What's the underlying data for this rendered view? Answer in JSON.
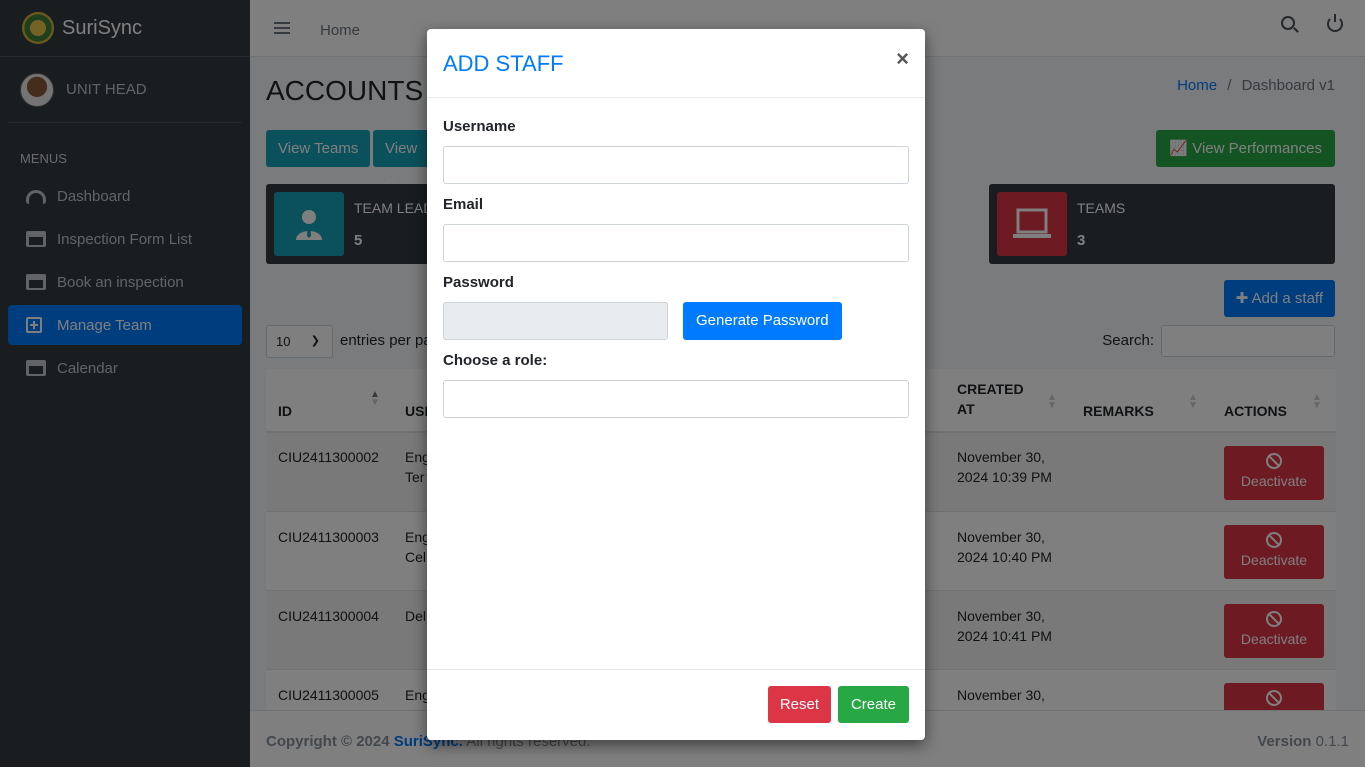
{
  "brand": {
    "name_light": "Suri",
    "name_regular": "Sync"
  },
  "user": {
    "role": "UNIT HEAD"
  },
  "sidebar": {
    "header": "MENUS",
    "items": [
      {
        "label": "Dashboard",
        "icon": "gauge-icon"
      },
      {
        "label": "Inspection Form List",
        "icon": "calendar-icon"
      },
      {
        "label": "Book an inspection",
        "icon": "calendar-icon"
      },
      {
        "label": "Manage Team",
        "icon": "plus-square-icon",
        "active": true
      },
      {
        "label": "Calendar",
        "icon": "calendar-icon"
      }
    ]
  },
  "topbar": {
    "home": "Home"
  },
  "page": {
    "title": "ACCOUNTS",
    "breadcrumb_home": "Home",
    "breadcrumb_sep": "/",
    "breadcrumb_current": "Dashboard v1"
  },
  "buttons": {
    "view_teams": "View Teams",
    "view_s": "View S",
    "view_performances": "View Performances",
    "add_staff": "Add a staff"
  },
  "infoboxes": [
    {
      "label": "TEAM LEAD",
      "value": "5",
      "color": "#17a2b8"
    },
    {
      "label": "TEAMS",
      "value": "3",
      "color": "#dc3545"
    }
  ],
  "table_controls": {
    "length": "10",
    "length_label": "entries per pa",
    "search_label": "Search:"
  },
  "table": {
    "headers": {
      "id": "ID",
      "user": "USI",
      "created": "CREATED AT",
      "remarks": "REMARKS",
      "actions": "ACTIONS"
    },
    "rows": [
      {
        "id": "CIU2411300002",
        "user1": "Eng",
        "user2": "Ter",
        "created1": "November 30,",
        "created2": "2024 10:39 PM",
        "action": "Deactivate"
      },
      {
        "id": "CIU2411300003",
        "user1": "Eng",
        "user2": "Cel",
        "created1": "November 30,",
        "created2": "2024 10:40 PM",
        "action": "Deactivate"
      },
      {
        "id": "CIU2411300004",
        "user1": "Del",
        "user2": "",
        "created1": "November 30,",
        "created2": "2024 10:41 PM",
        "action": "Deactivate"
      },
      {
        "id": "CIU2411300005",
        "user1": "Eng",
        "user2": "",
        "created1": "November 30,",
        "created2": "",
        "action": ""
      }
    ]
  },
  "footer": {
    "copy_prefix": "Copyright © 2024 ",
    "brand": "SuriSync.",
    "copy_suffix": " All rights reserved.",
    "version_label": "Version",
    "version": "0.1.1"
  },
  "modal": {
    "title": "ADD STAFF",
    "close": "×",
    "username_label": "Username",
    "username_value": "",
    "email_label": "Email",
    "email_value": "",
    "password_label": "Password",
    "password_value": "",
    "generate_label": "Generate Password",
    "role_label": "Choose a role:",
    "role_value": "",
    "reset_label": "Reset",
    "create_label": "Create"
  },
  "colors": {
    "primary": "#007bff",
    "success": "#28a745",
    "danger": "#dc3545",
    "info": "#17a2b8",
    "sidebar": "#343a40"
  }
}
